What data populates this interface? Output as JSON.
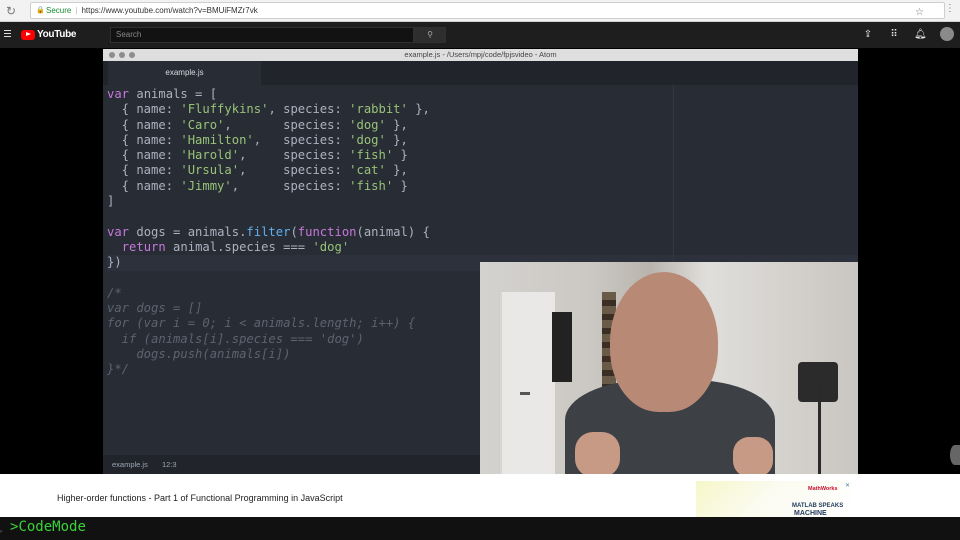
{
  "browser": {
    "secure_label": "Secure",
    "url": "https://www.youtube.com/watch?v=BMUiFMZr7vk"
  },
  "youtube": {
    "logo_text": "YouTube",
    "search_placeholder": "Search"
  },
  "atom": {
    "window_title": "example.js - /Users/mpj/code/fpjsvideo - Atom",
    "tab_label": "example.js",
    "status_file": "example.js",
    "status_position": "12:3"
  },
  "video": {
    "title": "Higher-order functions - Part 1 of Functional Programming in JavaScript"
  },
  "ad": {
    "brand": "MathWorks",
    "line1": "MATLAB SPEAKS",
    "line2": "MACHINE"
  },
  "banner": {
    "text": "CodeMode"
  }
}
